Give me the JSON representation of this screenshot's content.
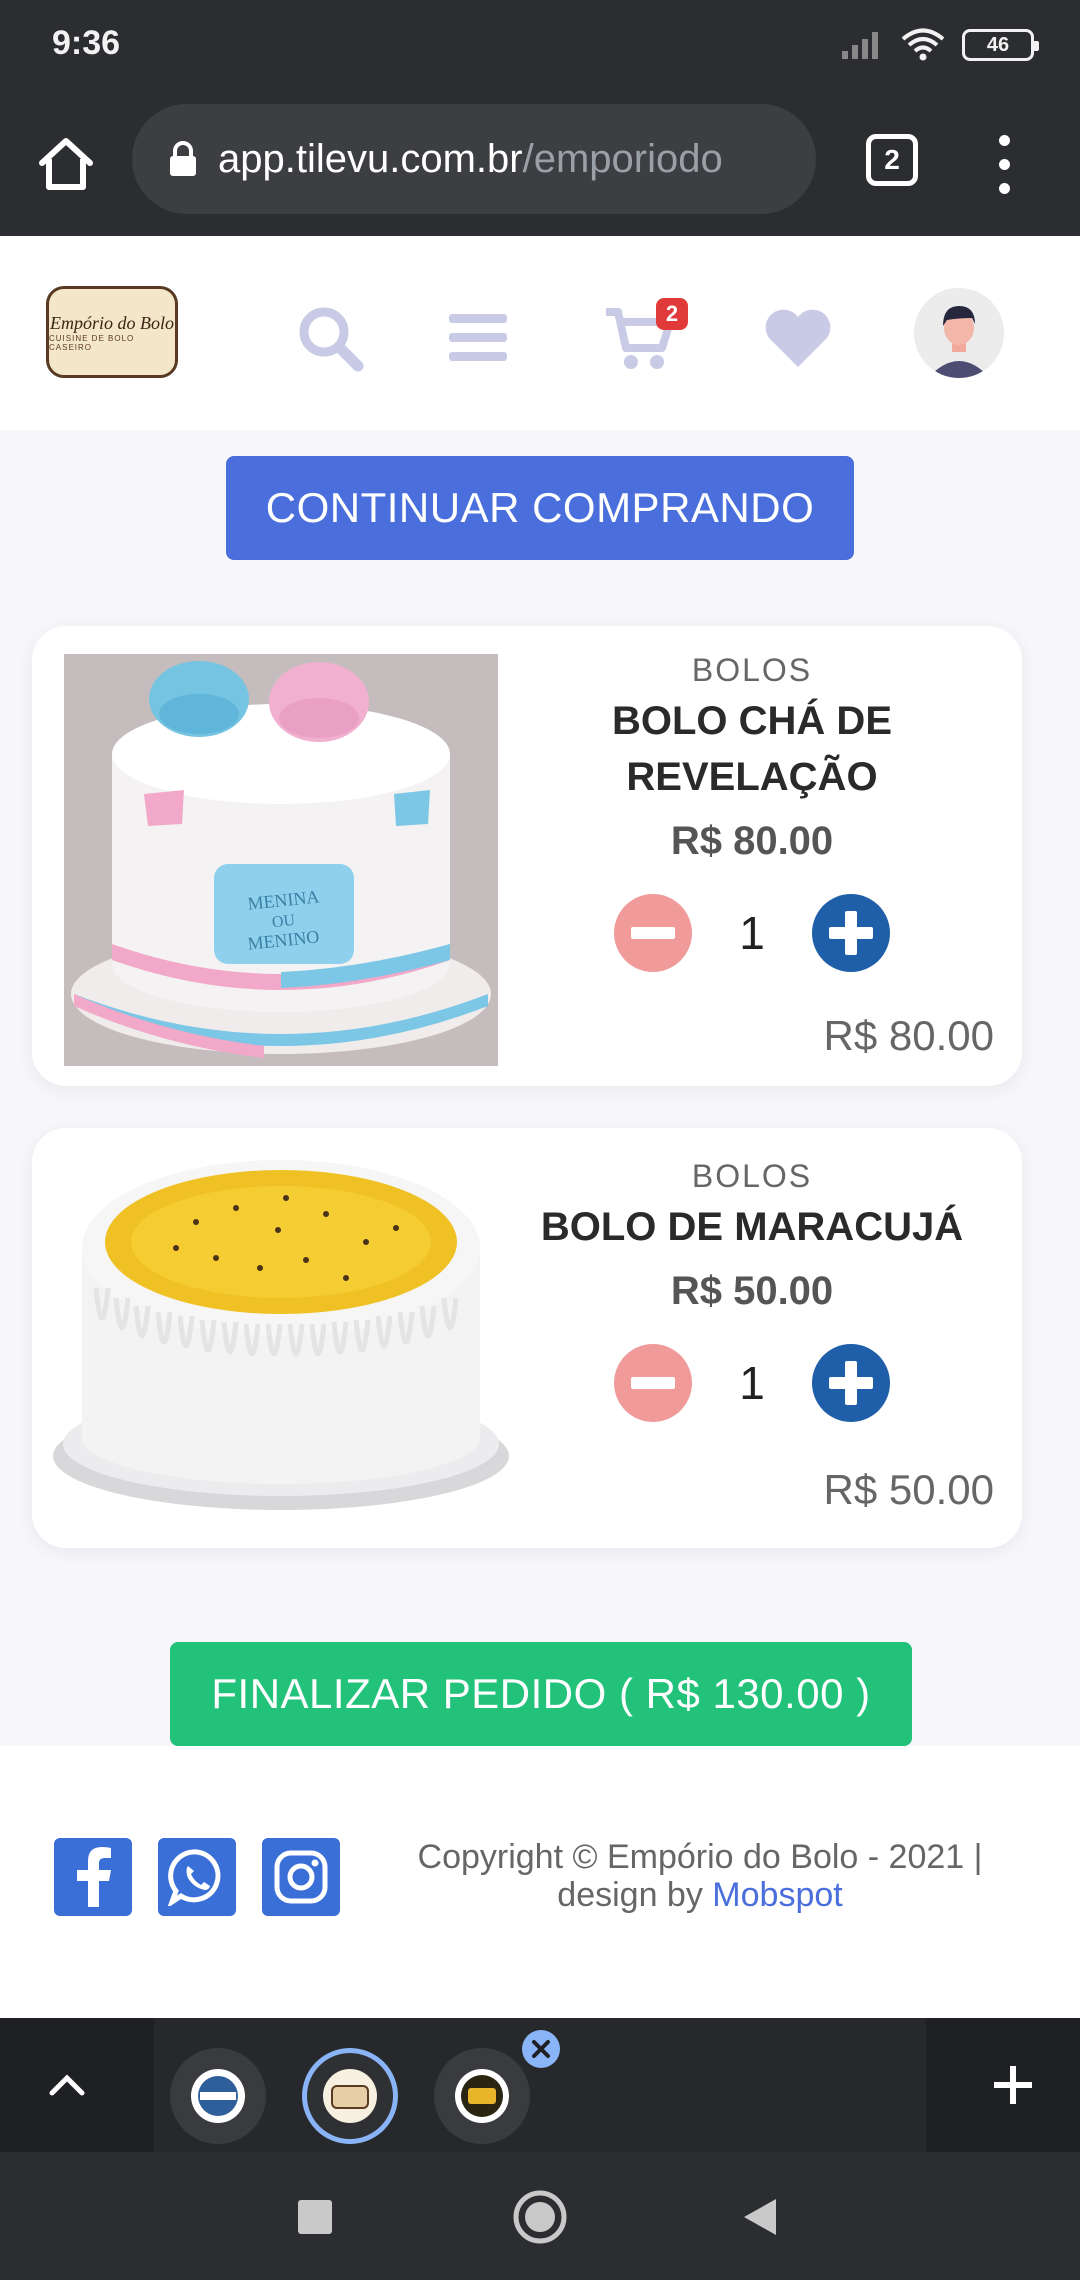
{
  "status_bar": {
    "time": "9:36",
    "battery": "46"
  },
  "browser": {
    "url_domain": "app.tilevu.com.br",
    "url_path": "/emporiodo",
    "tab_count": "2"
  },
  "header": {
    "logo_text": "Empório do Bolo",
    "logo_subtext": "CUISINE DE BOLO CASEIRO",
    "cart_count": "2",
    "icons": [
      "search-icon",
      "menu-icon",
      "cart-icon",
      "heart-icon",
      "avatar"
    ]
  },
  "main": {
    "continue_label": "CONTINUAR COMPRANDO",
    "items": [
      {
        "category": "BOLOS",
        "name": "BOLO CHÁ DE REVELAÇÃO",
        "unit_price": "R$ 80.00",
        "quantity": "1",
        "line_total": "R$ 80.00",
        "image_text": "MENINA OU MENINO"
      },
      {
        "category": "BOLOS",
        "name": "BOLO DE MARACUJÁ",
        "unit_price": "R$ 50.00",
        "quantity": "1",
        "line_total": "R$ 50.00"
      }
    ],
    "checkout_label": "FINALIZAR PEDIDO ( R$ 130.00 )"
  },
  "footer": {
    "copyright": "Copyright © Empório do Bolo - 2021 |",
    "design_by": "design by",
    "designer": "Mobspot",
    "social": [
      "facebook-icon",
      "whatsapp-icon",
      "instagram-icon"
    ]
  },
  "colors": {
    "primary_blue": "#4a6fdc",
    "checkout_green": "#22c27a",
    "minus_red": "#f09a9a",
    "plus_blue": "#1f5ea8",
    "badge_red": "#e03a3a",
    "icon_lavender": "#c9cbe6"
  }
}
